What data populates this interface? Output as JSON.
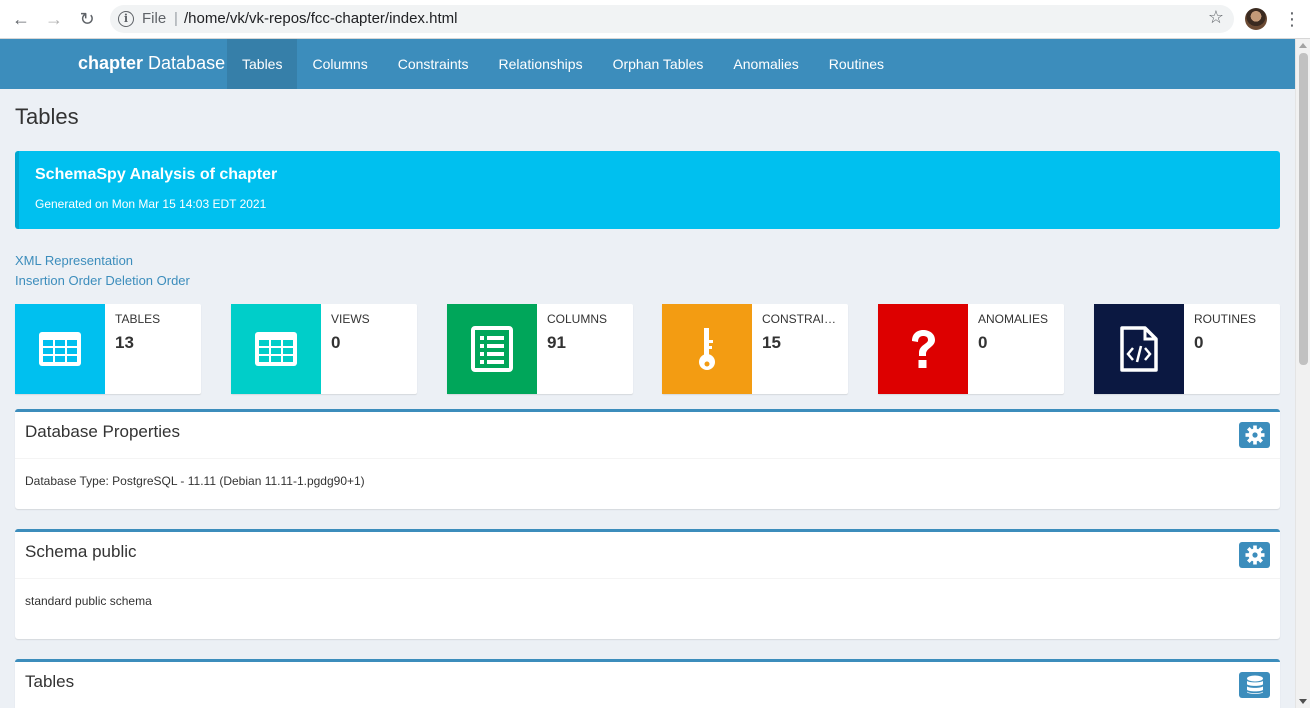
{
  "browser": {
    "scheme": "File",
    "url": "/home/vk/vk-repos/fcc-chapter/index.html"
  },
  "nav": {
    "brand_bold": "chapter",
    "brand_rest": " Database",
    "items": [
      {
        "label": "Tables",
        "active": true
      },
      {
        "label": "Columns"
      },
      {
        "label": "Constraints"
      },
      {
        "label": "Relationships"
      },
      {
        "label": "Orphan Tables"
      },
      {
        "label": "Anomalies"
      },
      {
        "label": "Routines"
      }
    ]
  },
  "page": {
    "title": "Tables",
    "callout_title": "SchemaSpy Analysis of chapter",
    "callout_sub": "Generated on Mon Mar 15 14:03 EDT 2021",
    "link_xml": "XML Representation",
    "link_insertion": "Insertion Order",
    "link_deletion": "Deletion Order"
  },
  "infoboxes": [
    {
      "label": "TABLES",
      "value": "13",
      "color": "#00c0ef",
      "icon": "table-icon"
    },
    {
      "label": "VIEWS",
      "value": "0",
      "color": "#00cec9",
      "icon": "table-icon"
    },
    {
      "label": "COLUMNS",
      "value": "91",
      "color": "#00a65a",
      "icon": "list-icon"
    },
    {
      "label": "CONSTRAINTS",
      "value": "15",
      "color": "#f39c12",
      "icon": "key-icon"
    },
    {
      "label": "ANOMALIES",
      "value": "0",
      "color": "#dd0000",
      "icon": "question-icon"
    },
    {
      "label": "ROUTINES",
      "value": "0",
      "color": "#0b1841",
      "icon": "code-file-icon"
    }
  ],
  "boxes": {
    "db_props_title": "Database Properties",
    "db_props_body": "Database Type: PostgreSQL - 11.11 (Debian 11.11-1.pgdg90+1)",
    "schema_title": "Schema public",
    "schema_body": "standard public schema",
    "tables_title": "Tables"
  }
}
